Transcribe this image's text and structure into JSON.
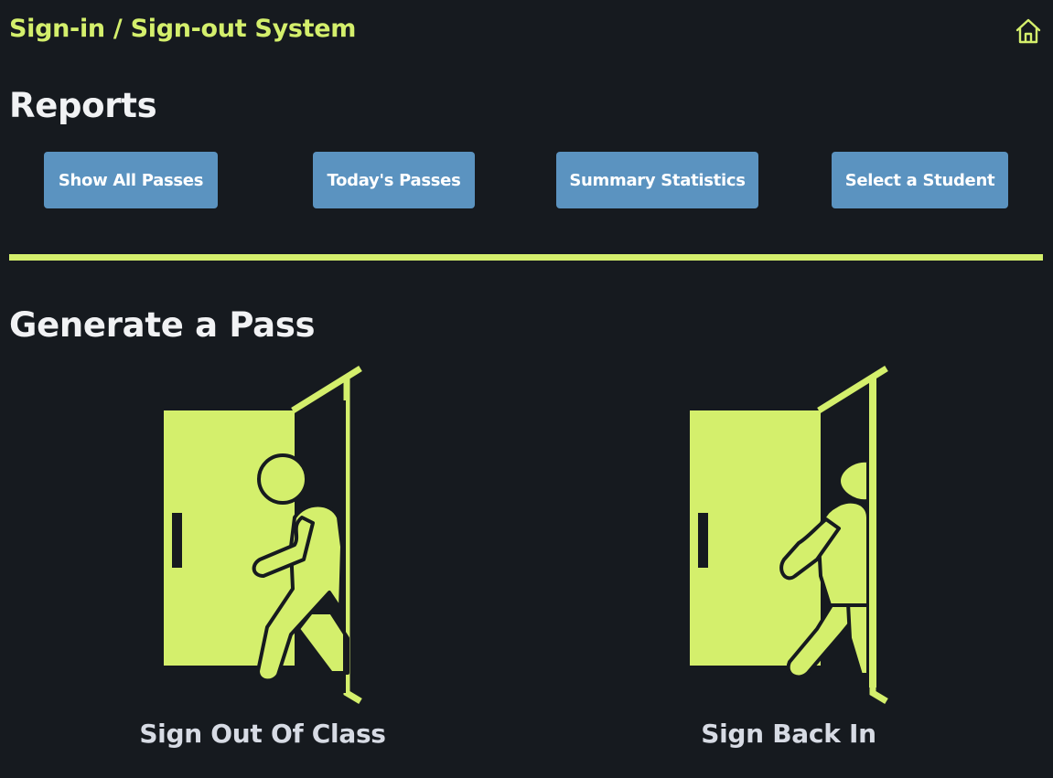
{
  "header": {
    "app_title": "Sign-in / Sign-out System",
    "home_icon": "home-icon"
  },
  "reports": {
    "title": "Reports",
    "buttons": [
      {
        "label": "Show All Passes"
      },
      {
        "label": "Today's Passes"
      },
      {
        "label": "Summary Statistics"
      },
      {
        "label": "Select a Student"
      }
    ]
  },
  "generate": {
    "title": "Generate a Pass",
    "options": [
      {
        "label": "Sign Out Of Class",
        "icon": "person-exiting-door-icon"
      },
      {
        "label": "Sign Back In",
        "icon": "person-entering-door-icon"
      }
    ]
  },
  "colors": {
    "accent": "#d4ef6c",
    "background": "#161a1f",
    "button": "#5b93c0",
    "heading": "#f1f2f4",
    "label": "#d7dbe4"
  }
}
